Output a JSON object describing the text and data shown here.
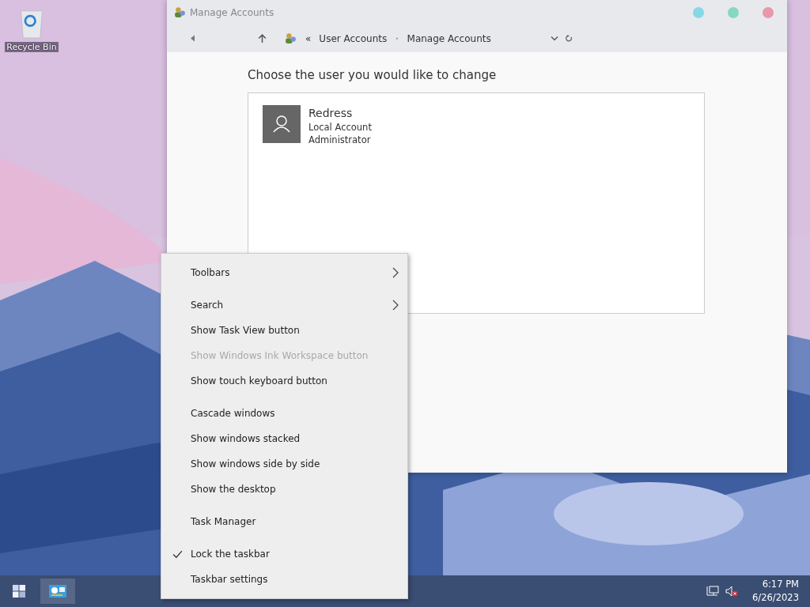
{
  "desktop": {
    "icons": [
      {
        "label": "Recycle Bin"
      }
    ]
  },
  "window": {
    "title": "Manage Accounts",
    "breadcrumb": [
      "User Accounts",
      "Manage Accounts"
    ],
    "overflow": "«",
    "separator": "•",
    "heading": "Choose the user you would like to change",
    "accounts": [
      {
        "name": "Redress",
        "type": "Local Account",
        "role": "Administrator"
      }
    ]
  },
  "context_menu": {
    "groups": [
      [
        {
          "label": "Toolbars",
          "kind": "submenu",
          "disabled": false,
          "checked": false
        }
      ],
      [
        {
          "label": "Search",
          "kind": "submenu",
          "disabled": false,
          "checked": false
        },
        {
          "label": "Show Task View button",
          "kind": "command",
          "disabled": false,
          "checked": false
        },
        {
          "label": "Show Windows Ink Workspace button",
          "kind": "command",
          "disabled": true,
          "checked": false
        },
        {
          "label": "Show touch keyboard button",
          "kind": "command",
          "disabled": false,
          "checked": false
        }
      ],
      [
        {
          "label": "Cascade windows",
          "kind": "command",
          "disabled": false,
          "checked": false
        },
        {
          "label": "Show windows stacked",
          "kind": "command",
          "disabled": false,
          "checked": false
        },
        {
          "label": "Show windows side by side",
          "kind": "command",
          "disabled": false,
          "checked": false
        },
        {
          "label": "Show the desktop",
          "kind": "command",
          "disabled": false,
          "checked": false
        }
      ],
      [
        {
          "label": "Task Manager",
          "kind": "command",
          "disabled": false,
          "checked": false
        }
      ],
      [
        {
          "label": "Lock the taskbar",
          "kind": "command",
          "disabled": false,
          "checked": true
        },
        {
          "label": "Taskbar settings",
          "kind": "command",
          "disabled": false,
          "checked": false
        }
      ]
    ]
  },
  "taskbar": {
    "time": "6:17 PM",
    "date": "6/26/2023"
  }
}
